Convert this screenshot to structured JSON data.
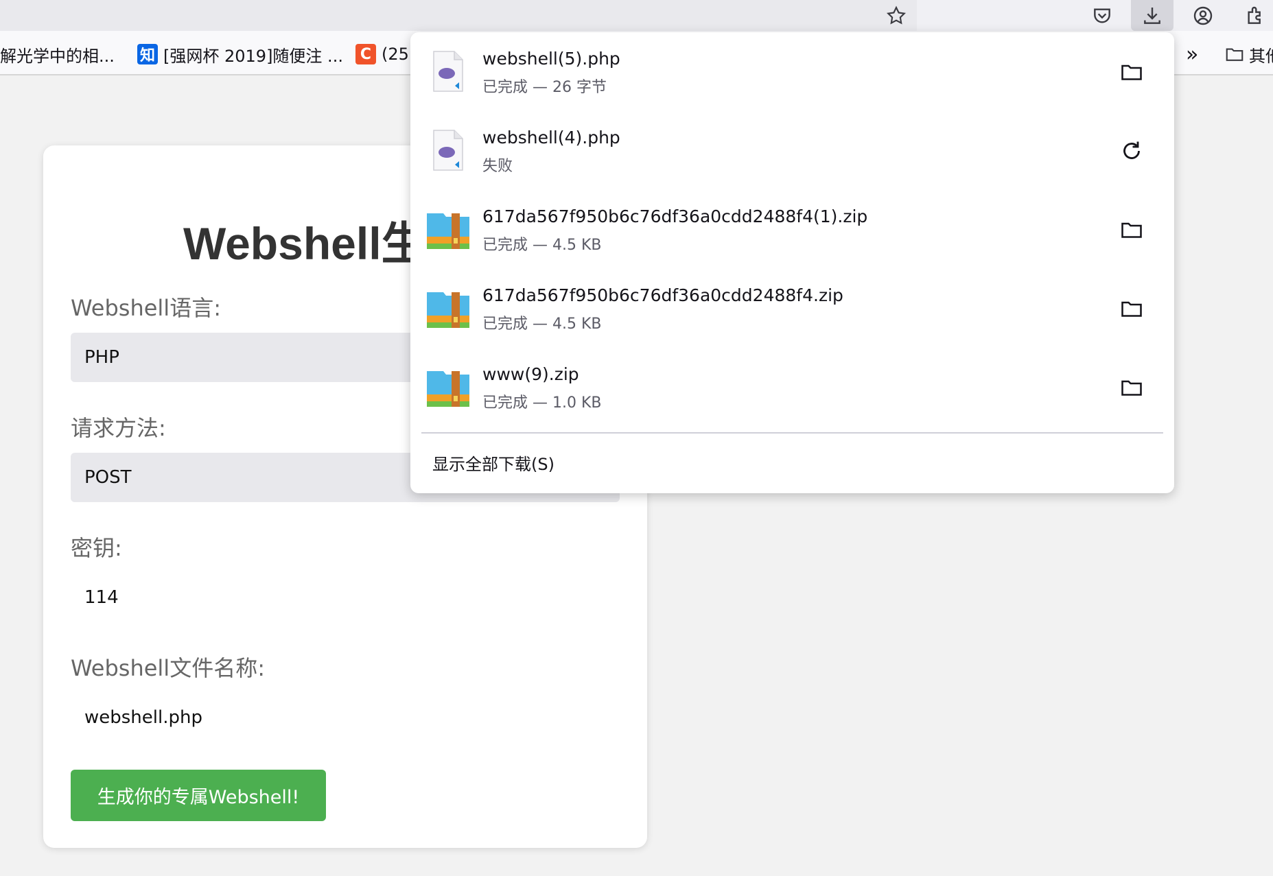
{
  "toolbar": {
    "icons": [
      "bookmark-star-icon",
      "pocket-icon",
      "downloads-icon",
      "account-icon",
      "extensions-icon"
    ]
  },
  "bookmarks": {
    "items": [
      {
        "label": "解光学中的相...",
        "favicon": ""
      },
      {
        "label": "[强网杯 2019]随便注 ...",
        "favicon": "知",
        "color": "#0a66e4"
      },
      {
        "label": "(25",
        "favicon": "C",
        "color": "#f0532a"
      }
    ],
    "overflow_label": "»",
    "other_label": "其他"
  },
  "page": {
    "title": "Webshell生",
    "language_label": "Webshell语言:",
    "language_value": "PHP",
    "method_label": "请求方法:",
    "method_value": "POST",
    "key_label": "密钥:",
    "key_value": "114",
    "filename_label": "Webshell文件名称:",
    "filename_value": "webshell.php",
    "generate_button": "生成你的专属Webshell!",
    "accent_color": "#4caf50"
  },
  "downloads": {
    "items": [
      {
        "name": "webshell(5).php",
        "status": "已完成 — 26 字节",
        "icon": "php-file-icon",
        "action": "folder-icon"
      },
      {
        "name": "webshell(4).php",
        "status": "失败",
        "icon": "php-file-icon",
        "action": "retry-icon"
      },
      {
        "name": "617da567f950b6c76df36a0cdd2488f4(1).zip",
        "status": "已完成 — 4.5 KB",
        "icon": "zip-archive-icon",
        "action": "folder-icon"
      },
      {
        "name": "617da567f950b6c76df36a0cdd2488f4.zip",
        "status": "已完成 — 4.5 KB",
        "icon": "zip-archive-icon",
        "action": "folder-icon"
      },
      {
        "name": "www(9).zip",
        "status": "已完成 — 1.0 KB",
        "icon": "zip-archive-icon",
        "action": "folder-icon"
      }
    ],
    "show_all": "显示全部下载(S)"
  }
}
